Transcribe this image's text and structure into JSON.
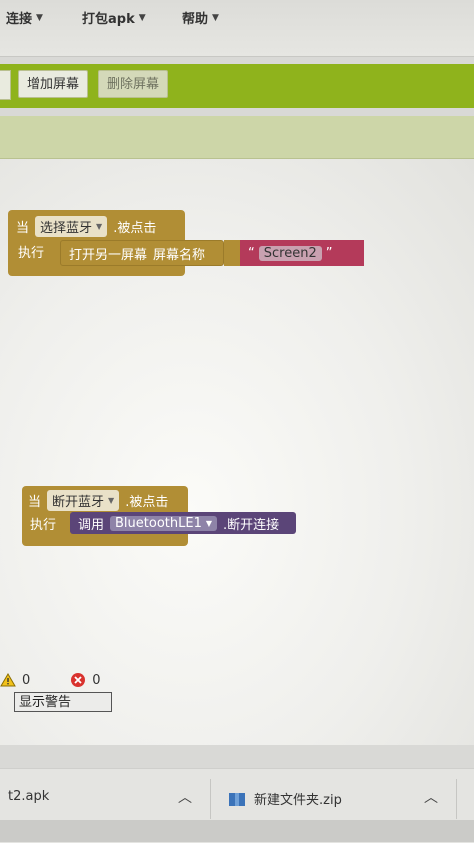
{
  "menu": [
    {
      "label": "连接"
    },
    {
      "label": "打包apk"
    },
    {
      "label": "帮助"
    }
  ],
  "toolbar": {
    "add_screen": "增加屏幕",
    "remove_screen": "删除屏幕"
  },
  "block1": {
    "when": "当",
    "component": "选择蓝牙",
    "event": ".被点击",
    "do": "执行",
    "action": "打开另一屏幕",
    "param": "屏幕名称",
    "quote_open": "“",
    "screen_value": "Screen2",
    "quote_close": "”"
  },
  "block2": {
    "when": "当",
    "component": "断开蓝牙",
    "event": ".被点击",
    "do": "执行",
    "call": "调用",
    "ble_component": "BluetoothLE1",
    "method": ".断开连接"
  },
  "warnings": {
    "warning_count": "0",
    "error_count": "0",
    "show_button": "显示警告"
  },
  "downloads": [
    {
      "name": "t2.apk"
    },
    {
      "name": "新建文件夹.zip"
    }
  ],
  "colors": {
    "event_block": "#b18e35",
    "text_block": "#b43a5a",
    "ble_block": "#5b4578",
    "toolbar": "#8fb31c"
  }
}
